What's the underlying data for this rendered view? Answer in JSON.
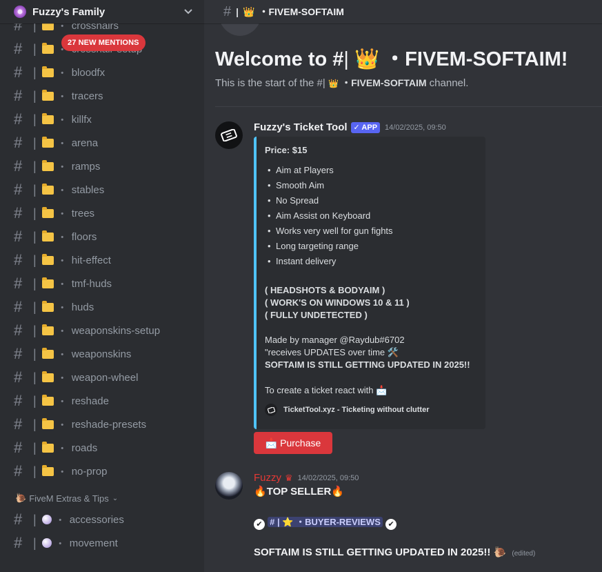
{
  "server": {
    "name": "Fuzzy's Family"
  },
  "mentions": {
    "label": "27 NEW MENTIONS"
  },
  "channels": [
    {
      "name": "crosshairs"
    },
    {
      "name": "crosshair-setup"
    },
    {
      "name": "bloodfx"
    },
    {
      "name": "tracers"
    },
    {
      "name": "killfx"
    },
    {
      "name": "arena"
    },
    {
      "name": "ramps"
    },
    {
      "name": "stables"
    },
    {
      "name": "trees"
    },
    {
      "name": "floors"
    },
    {
      "name": "hit-effect"
    },
    {
      "name": "tmf-huds"
    },
    {
      "name": "huds"
    },
    {
      "name": "weaponskins-setup"
    },
    {
      "name": "weaponskins"
    },
    {
      "name": "weapon-wheel"
    },
    {
      "name": "reshade"
    },
    {
      "name": "reshade-presets"
    },
    {
      "name": "roads"
    },
    {
      "name": "no-prop"
    }
  ],
  "category": {
    "name": "FiveM Extras & Tips"
  },
  "extra_channels": [
    {
      "name": "accessories"
    },
    {
      "name": "movement"
    }
  ],
  "topbar": {
    "channel": "・FIVEM-SOFTAIM"
  },
  "welcome": {
    "title_prefix": "Welcome to #",
    "title_channel": "・FIVEM-SOFTAIM!",
    "sub_prefix": "This is the start of the #",
    "sub_channel": "・FIVEM-SOFTAIM",
    "sub_suffix": " channel."
  },
  "ticket_message": {
    "author": "Fuzzy's Ticket Tool",
    "badge": "✓ APP",
    "time": "14/02/2025, 09:50",
    "price": "Price: $15",
    "features": [
      "Aim at Players",
      "Smooth Aim",
      "No Spread",
      "Aim Assist on Keyboard",
      "Works very well for gun fights",
      "Long targeting range",
      "Instant delivery"
    ],
    "bold_lines": [
      "( HEADSHOTS & BODYAIM )",
      "( WORK'S ON WINDOWS 10 & 11 )",
      "( FULLY UNDETECTED )"
    ],
    "made_by": "Made by manager @Raydub#6702",
    "updates": "\"receives UPDATES over time",
    "updated_2025": "SOFTAIM IS STILL GETTING UPDATED IN 2025!!",
    "create_ticket": "To create a ticket react with",
    "footer": "TicketTool.xyz - Ticketing without clutter",
    "purchase_label": "Purchase"
  },
  "fuzzy_message": {
    "author": "Fuzzy",
    "time": "14/02/2025, 09:50",
    "top_seller": "TOP SELLER",
    "reviews_channel": "・BUYER-REVIEWS",
    "updated_line": "SOFTAIM IS STILL GETTING UPDATED IN 2025!!",
    "edited": "(edited)"
  },
  "colors": {
    "accent_red": "#da373c",
    "embed_border": "#4fc3f7",
    "app_badge": "#5865f2"
  }
}
